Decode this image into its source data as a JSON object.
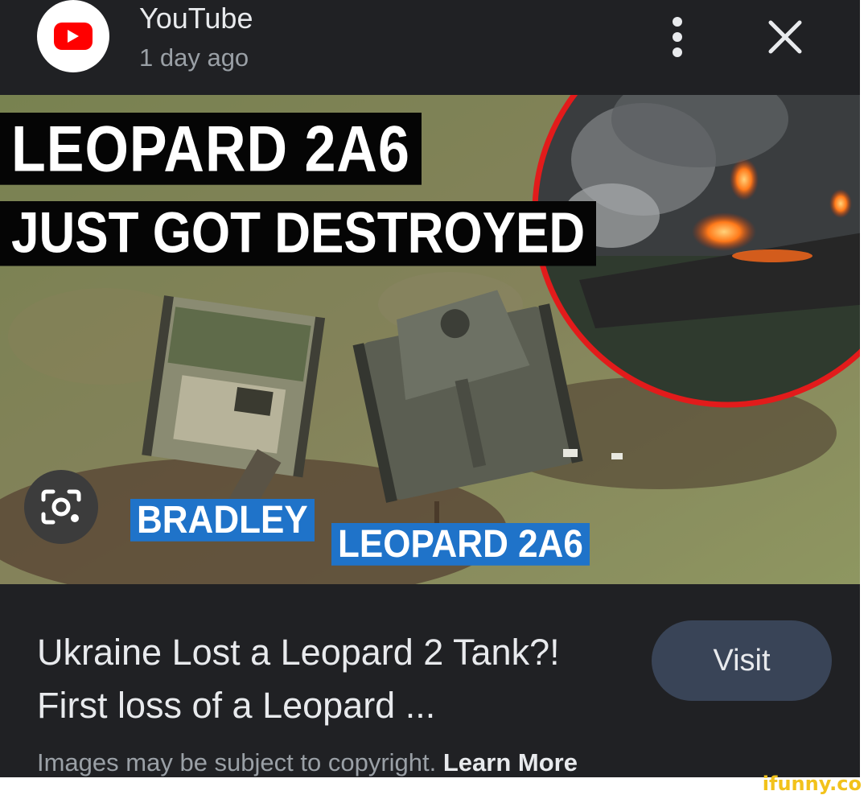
{
  "header": {
    "source_name": "YouTube",
    "time_ago": "1 day ago",
    "source_icon": "youtube-play-icon",
    "more_icon": "more-vertical-icon",
    "close_icon": "close-icon"
  },
  "image": {
    "caption_line_1": "LEOPARD 2A6",
    "caption_line_2": "JUST GOT DESTROYED",
    "label_left": "BRADLEY",
    "label_right": "LEOPARD 2A6",
    "lens_icon": "google-lens-icon"
  },
  "result": {
    "title": "Ukraine Lost a Leopard 2 Tank?! First loss of a Leopard ...",
    "visit_label": "Visit",
    "copyright_text": "Images may be subject to copyright.",
    "learn_more_label": "Learn More"
  },
  "watermark": "ifunny.co",
  "colors": {
    "background": "#202124",
    "visit_button": "#394457",
    "caption_blue": "#1f73c9",
    "inset_ring": "#e21b1b",
    "youtube_red": "#ff0000"
  }
}
